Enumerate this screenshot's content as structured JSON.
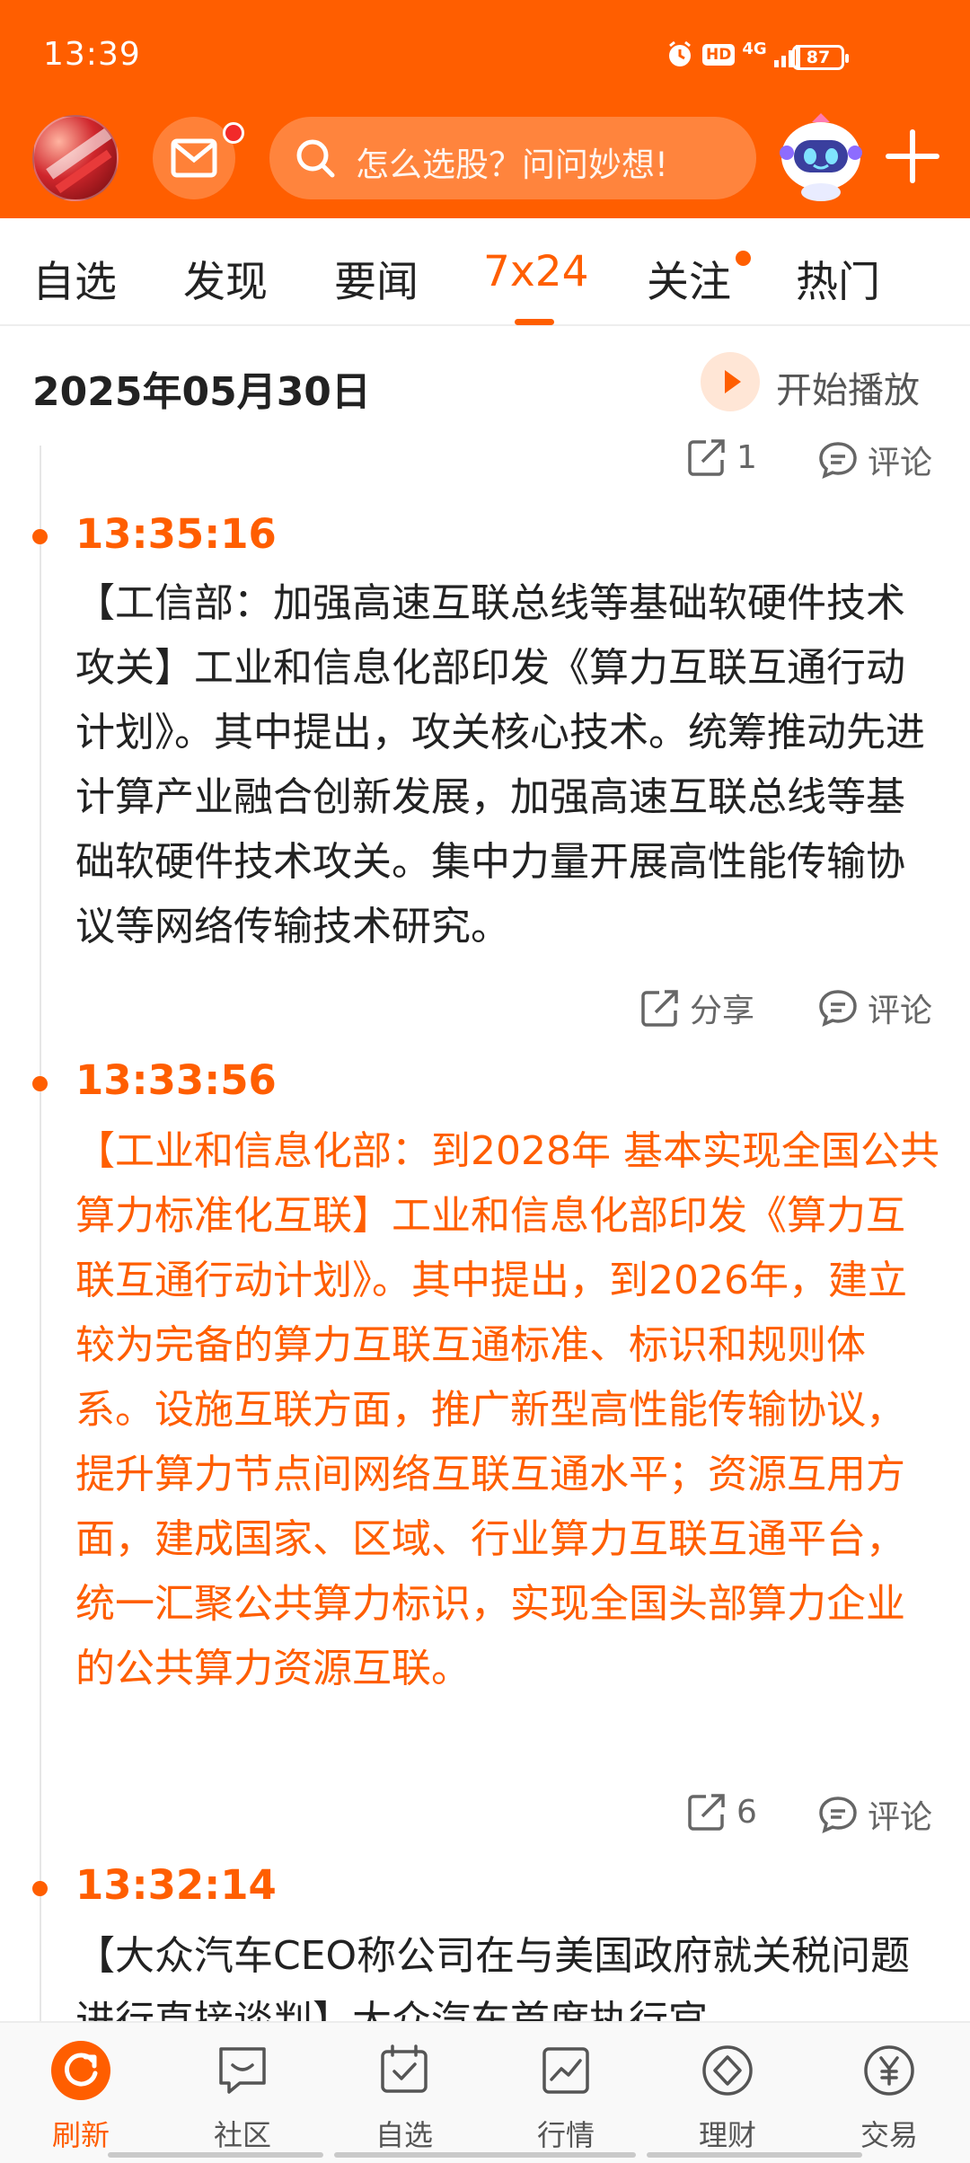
{
  "status_bar": {
    "time": "13:39",
    "battery": "87",
    "network": "4G",
    "hd": "HD"
  },
  "header": {
    "search_placeholder": "怎么选股？问问妙想!"
  },
  "tabs": [
    {
      "label": "自选"
    },
    {
      "label": "发现"
    },
    {
      "label": "要闻"
    },
    {
      "label": "7x24"
    },
    {
      "label": "关注"
    },
    {
      "label": "热门"
    }
  ],
  "date_label": "2025年05月30日",
  "play_label": "开始播放",
  "top_actions": {
    "share": "1",
    "comment": "评论"
  },
  "news": [
    {
      "time": "13:35:16",
      "text": "【工信部：加强高速互联总线等基础软硬件技术攻关】工业和信息化部印发《算力互联互通行动计划》。其中提出，攻关核心技术。统筹推动先进计算产业融合创新发展，加强高速互联总线等基础软硬件技术攻关。集中力量开展高性能传输协议等网络传输技术研究。",
      "share": "分享",
      "comment": "评论"
    },
    {
      "time": "13:33:56",
      "text": "【工业和信息化部：到2028年 基本实现全国公共算力标准化互联】工业和信息化部印发《算力互联互通行动计划》。其中提出，到2026年，建立较为完备的算力互联互通标准、标识和规则体系。设施互联方面，推广新型高性能传输协议，提升算力节点间网络互联互通水平；资源互用方面，建成国家、区域、行业算力互联互通平台，统一汇聚公共算力标识，实现全国头部算力企业的公共算力资源互联。",
      "share": "6",
      "comment": "评论"
    },
    {
      "time": "13:32:14",
      "text": "【大众汽车CEO称公司在与美国政府就关税问题进行直接谈判】大众汽车首席执行官"
    }
  ],
  "bottom_nav": [
    {
      "label": "刷新",
      "icon": "refresh-icon"
    },
    {
      "label": "社区",
      "icon": "community-icon"
    },
    {
      "label": "自选",
      "icon": "watchlist-icon"
    },
    {
      "label": "行情",
      "icon": "market-icon"
    },
    {
      "label": "理财",
      "icon": "wealth-icon"
    },
    {
      "label": "交易",
      "icon": "trade-icon"
    }
  ],
  "colors": {
    "brand": "#ff5e00",
    "text": "#222222",
    "muted": "#666666"
  }
}
